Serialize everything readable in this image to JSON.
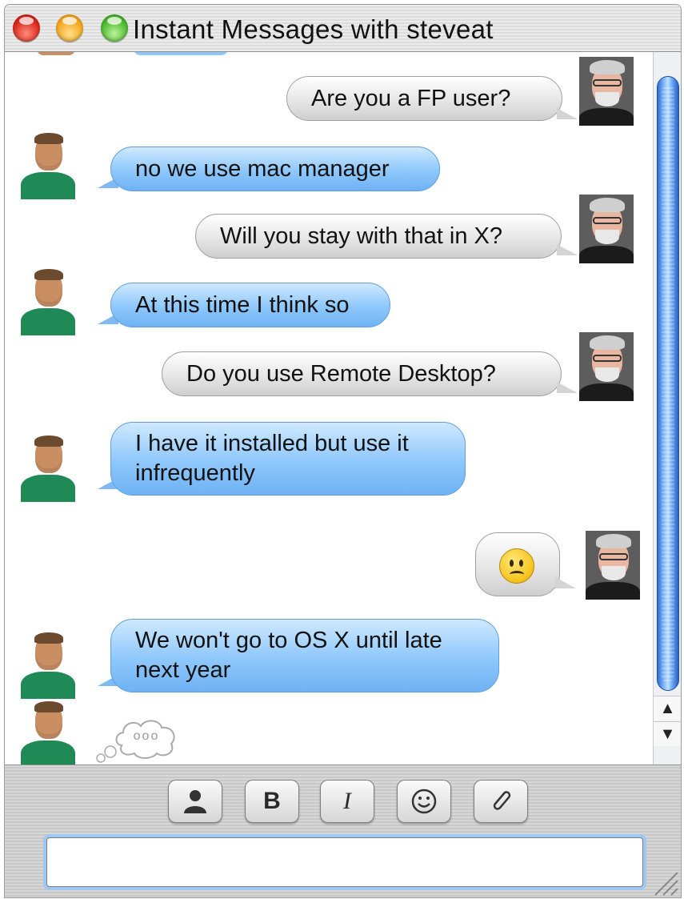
{
  "window": {
    "title": "Instant Messages with steveat"
  },
  "participants": {
    "me": {
      "avatar_icon": "buddy-photo-gray-hair-glasses"
    },
    "them": {
      "avatar_icon": "buddy-photo-green-shirt"
    }
  },
  "messages": [
    {
      "sender": "me",
      "text": "Are you a FP user?"
    },
    {
      "sender": "them",
      "text": "no we use mac manager"
    },
    {
      "sender": "me",
      "text": "Will you stay with that in X?"
    },
    {
      "sender": "them",
      "text": "At this time I think so"
    },
    {
      "sender": "me",
      "text": "Do you use Remote Desktop?"
    },
    {
      "sender": "them",
      "line1": "I have it installed but use it",
      "line2": "infrequently"
    },
    {
      "sender": "me",
      "emoticon": "frown-emoticon"
    },
    {
      "sender": "them",
      "line1": "We won't go to OS X until late",
      "line2": "next year"
    }
  ],
  "typing_indicator": {
    "text": "ooo"
  },
  "scrollbar": {
    "up_glyph": "▲",
    "down_glyph": "▼"
  },
  "toolbar": {
    "buttons": [
      {
        "name": "buddy-icon",
        "glyph": "👤"
      },
      {
        "name": "bold",
        "glyph": "B"
      },
      {
        "name": "italic",
        "glyph": "I"
      },
      {
        "name": "smiley-icon",
        "glyph": "☺"
      },
      {
        "name": "attach-icon",
        "glyph": "📎"
      }
    ]
  },
  "input": {
    "value": "",
    "placeholder": ""
  },
  "colors": {
    "my_bubble": "#e6e6e6",
    "their_bubble": "#8ec7fb",
    "scroll_thumb": "#4f8ce8"
  }
}
